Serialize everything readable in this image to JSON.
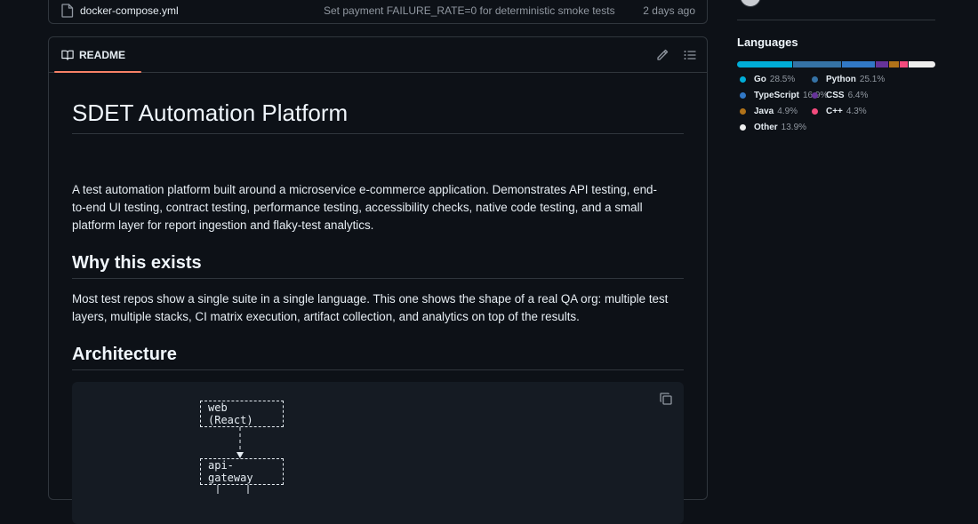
{
  "file_row": {
    "name": "docker-compose.yml",
    "message": "Set payment FAILURE_RATE=0 for deterministic smoke tests",
    "date": "2 days ago"
  },
  "readme": {
    "tab_label": "README",
    "title": "SDET Automation Platform",
    "intro": "A test automation platform built around a microservice e-commerce application. Demonstrates API testing, end-to-end UI testing, contract testing, performance testing, accessibility checks, native code testing, and a small platform layer for report ingestion and flaky-test analytics.",
    "why_heading": "Why this exists",
    "why_text": "Most test repos show a single suite in a single language. This one shows the shape of a real QA org: multiple test layers, multiple stacks, CI matrix execution, artifact collection, and analytics on top of the results.",
    "arch_heading": "Architecture",
    "diagram": {
      "node_web": "web (React)",
      "node_gateway": "api-gateway"
    }
  },
  "languages": {
    "title": "Languages",
    "items": [
      {
        "name": "Go",
        "pct": "28.5%",
        "value": 28.5,
        "color": "#00add8"
      },
      {
        "name": "Python",
        "pct": "25.1%",
        "value": 25.1,
        "color": "#3572a5"
      },
      {
        "name": "TypeScript",
        "pct": "16.9%",
        "value": 16.9,
        "color": "#3178c6"
      },
      {
        "name": "CSS",
        "pct": "6.4%",
        "value": 6.4,
        "color": "#663399"
      },
      {
        "name": "Java",
        "pct": "4.9%",
        "value": 4.9,
        "color": "#b07219"
      },
      {
        "name": "C++",
        "pct": "4.3%",
        "value": 4.3,
        "color": "#f34b7d"
      },
      {
        "name": "Other",
        "pct": "13.9%",
        "value": 13.9,
        "color": "#ededed"
      }
    ]
  }
}
